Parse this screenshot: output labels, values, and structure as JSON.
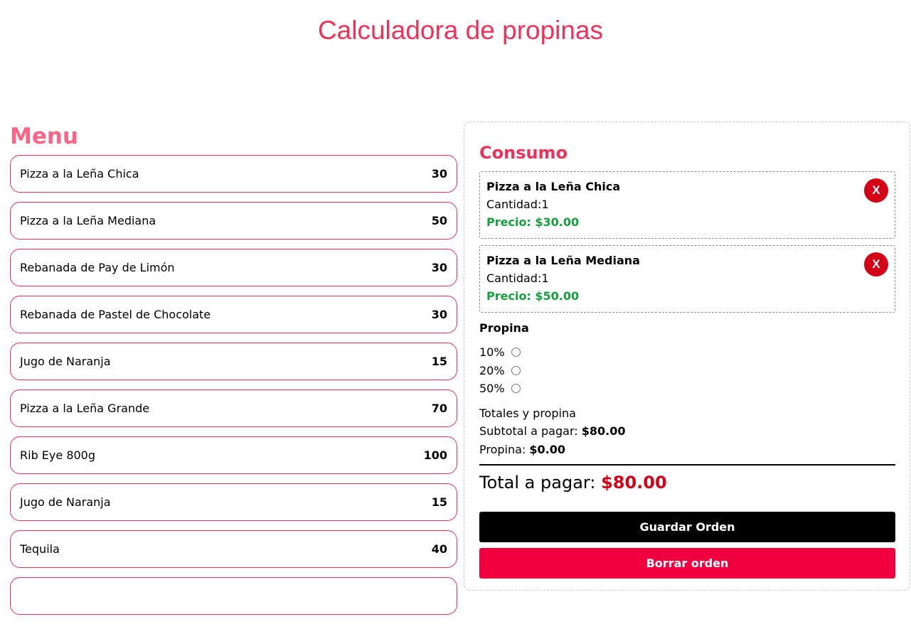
{
  "page": {
    "title": "Calculadora de propinas"
  },
  "menu": {
    "heading": "Menu",
    "items": [
      {
        "name": "Pizza a la Leña Chica",
        "price": "30"
      },
      {
        "name": "Pizza a la Leña Mediana",
        "price": "50"
      },
      {
        "name": "Rebanada de Pay de Limón",
        "price": "30"
      },
      {
        "name": "Rebanada de Pastel de Chocolate",
        "price": "30"
      },
      {
        "name": "Jugo de Naranja",
        "price": "15"
      },
      {
        "name": "Pizza a la Leña Grande",
        "price": "70"
      },
      {
        "name": "Rib Eye 800g",
        "price": "100"
      },
      {
        "name": "Jugo de Naranja",
        "price": "15"
      },
      {
        "name": "Tequila",
        "price": "40"
      }
    ]
  },
  "consumo": {
    "heading": "Consumo",
    "items": [
      {
        "name": "Pizza a la Leña Chica",
        "qty": "Cantidad:1",
        "price": "Precio: $30.00",
        "remove": "X"
      },
      {
        "name": "Pizza a la Leña Mediana",
        "qty": "Cantidad:1",
        "price": "Precio: $50.00",
        "remove": "X"
      }
    ],
    "tip": {
      "title": "Propina",
      "options": [
        "10%",
        "20%",
        "50%"
      ],
      "selected": null
    },
    "totals": {
      "heading": "Totales y propina",
      "subtotal_label": "Subtotal a pagar: ",
      "subtotal_value": "$80.00",
      "tip_label": "Propina: ",
      "tip_value": "$0.00",
      "total_label": "Total a pagar: ",
      "total_value": "$80.00"
    },
    "buttons": {
      "save": "Guardar Orden",
      "clear": "Borrar orden"
    }
  },
  "colors": {
    "accent": "#f0325a",
    "menu_heading": "#fb6585",
    "price_green": "#14a03c",
    "danger": "#d40015",
    "clear_button": "#f0003e"
  }
}
